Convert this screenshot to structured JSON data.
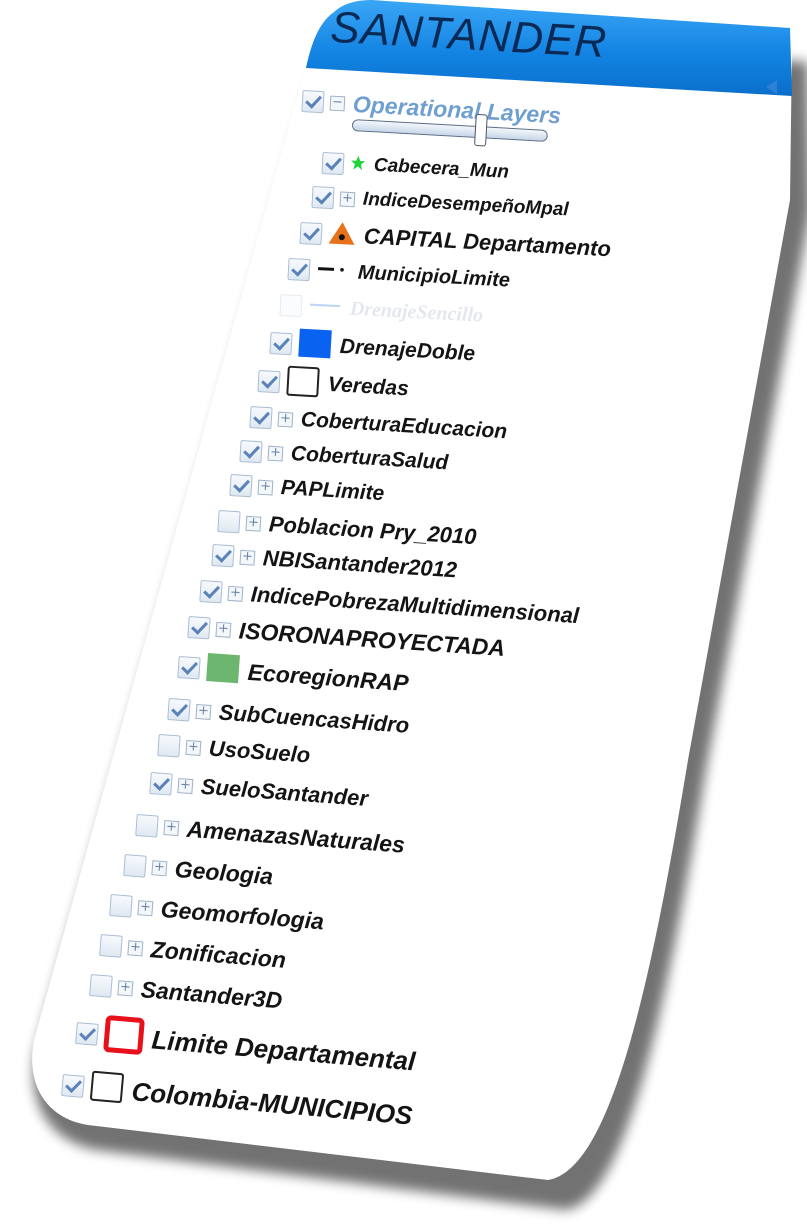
{
  "header": {
    "title": "SANTANDER",
    "accent_color": "#1a8ee6"
  },
  "group": {
    "label": "Operational Layers",
    "checked": true,
    "expander": "−"
  },
  "opacity_slider": {
    "value": 0.67
  },
  "layers": [
    {
      "label": "Cabecera_Mun",
      "checked": true,
      "symbol": "green-star"
    },
    {
      "label": "IndiceDesempeñoMpal",
      "checked": true,
      "symbol": "expander"
    },
    {
      "label": "CAPITAL Departamento",
      "checked": true,
      "symbol": "orange-triangle"
    },
    {
      "label": "MunicipioLimite",
      "checked": true,
      "symbol": "dash-dot-line"
    },
    {
      "label": "DrenajeSencillo",
      "checked": false,
      "symbol": "light-blue-line"
    },
    {
      "label": "DrenajeDoble",
      "checked": true,
      "symbol": "blue-square"
    },
    {
      "label": "Veredas",
      "checked": true,
      "symbol": "outline-square"
    },
    {
      "label": "CoberturaEducacion",
      "checked": true,
      "symbol": "expander"
    },
    {
      "label": "CoberturaSalud",
      "checked": true,
      "symbol": "expander"
    },
    {
      "label": "PAPLimite",
      "checked": true,
      "symbol": "expander"
    },
    {
      "label": "Poblacion Pry_2010",
      "checked": false,
      "symbol": "expander"
    },
    {
      "label": "NBISantander2012",
      "checked": true,
      "symbol": "expander"
    },
    {
      "label": "IndicePobrezaMultidimensional",
      "checked": true,
      "symbol": "expander"
    },
    {
      "label": "ISORONAPROYECTADA",
      "checked": true,
      "symbol": "expander"
    },
    {
      "label": "EcoregionRAP",
      "checked": true,
      "symbol": "green-square"
    },
    {
      "label": "SubCuencasHidro",
      "checked": true,
      "symbol": "expander"
    },
    {
      "label": "UsoSuelo",
      "checked": false,
      "symbol": "expander"
    },
    {
      "label": "SueloSantander",
      "checked": true,
      "symbol": "expander"
    },
    {
      "label": "AmenazasNaturales",
      "checked": false,
      "symbol": "expander"
    },
    {
      "label": "Geologia",
      "checked": false,
      "symbol": "expander"
    },
    {
      "label": "Geomorfologia",
      "checked": false,
      "symbol": "expander"
    },
    {
      "label": "Zonificacion",
      "checked": false,
      "symbol": "expander"
    },
    {
      "label": "Santander3D",
      "checked": false,
      "symbol": "expander"
    },
    {
      "label": "Limite Departamental",
      "checked": true,
      "symbol": "red-outline-square"
    },
    {
      "label": "Colombia-MUNICIPIOS",
      "checked": true,
      "symbol": "outline-square"
    }
  ],
  "colors": {
    "star": "#1fd13a",
    "triangle": "#e8711c",
    "drenaje_doble": "#0a62f0",
    "ecoregion": "#6cb66f",
    "limite_departamental": "#e8111b"
  }
}
